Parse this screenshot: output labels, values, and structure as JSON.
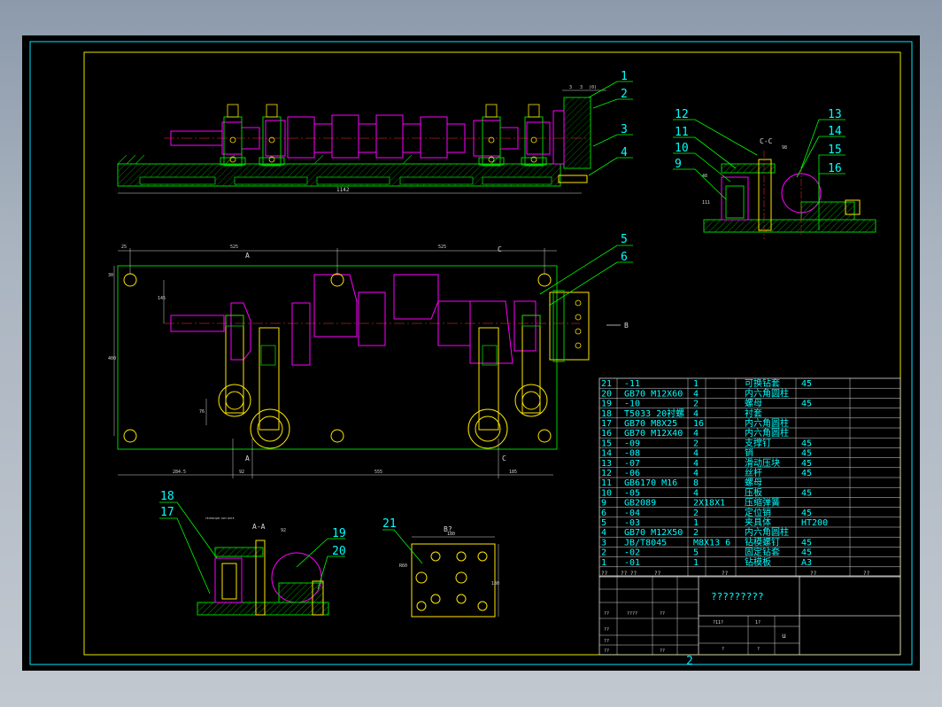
{
  "sheet": {
    "sheet_number": "2",
    "border_color": "#00e5ff",
    "frame_color": "#e6e600"
  },
  "colors": {
    "part_green": "#00d000",
    "shaft_magenta": "#ff00ff",
    "dim_white": "#d8d8d8",
    "leader_green": "#00ff00",
    "text_cyan": "#00ffff",
    "bolt_yellow": "#ffe600",
    "center_red": "#ff3030"
  },
  "front_view": {
    "dimension_overall": "1142",
    "dims_top": [
      "3",
      "3",
      "(0)"
    ],
    "balloons": [
      "1",
      "2",
      "3",
      "4"
    ]
  },
  "top_view": {
    "dims": {
      "left_offset": "25",
      "span_left": "525",
      "span_right": "525",
      "height": "400",
      "side_a": "30",
      "side_b": "145",
      "bottom_left": "284.5",
      "bottom_mid": "92",
      "bottom_span": "555",
      "bottom_right": "185",
      "small_v": "76"
    },
    "section_marks": [
      "A",
      "C",
      "A",
      "C",
      "B"
    ],
    "balloons": [
      "5",
      "6"
    ]
  },
  "view_cc": {
    "title": "C-C",
    "dim": "98",
    "side_dim": "48",
    "small_dim": "111",
    "balloons": [
      "12",
      "11",
      "10",
      "9",
      "13",
      "14",
      "15",
      "16"
    ]
  },
  "view_aa": {
    "title": "A-A",
    "dim": "92",
    "note": "TECHNIQUE DIM NOTE",
    "balloons": [
      "18",
      "17",
      "19",
      "20"
    ]
  },
  "view_b": {
    "title": "B?",
    "dim_top": "180",
    "dim_side": "180",
    "hole_dim": "R60",
    "balloons": [
      "21"
    ]
  },
  "bom": {
    "rows": [
      {
        "no": "21",
        "code": "-11",
        "qty": "1",
        "name": "可换钻套",
        "mat": "45"
      },
      {
        "no": "20",
        "code": "GB70    M12X60",
        "qty": "4",
        "name": "内六角圆柱",
        "mat": ""
      },
      {
        "no": "19",
        "code": "-10",
        "qty": "2",
        "name": "螺母",
        "mat": "45"
      },
      {
        "no": "18",
        "code": "T5033   20衬螺",
        "qty": "4",
        "name": "衬套",
        "mat": ""
      },
      {
        "no": "17",
        "code": "GB70    M8X25",
        "qty": "16",
        "name": "内六角圆柱",
        "mat": ""
      },
      {
        "no": "16",
        "code": "GB70    M12X40",
        "qty": "4",
        "name": "内六角圆柱",
        "mat": ""
      },
      {
        "no": "15",
        "code": "-09",
        "qty": "2",
        "name": "支撑钉",
        "mat": "45"
      },
      {
        "no": "14",
        "code": "-08",
        "qty": "4",
        "name": "销",
        "mat": "45"
      },
      {
        "no": "13",
        "code": "-07",
        "qty": "4",
        "name": "滑动压块",
        "mat": "45"
      },
      {
        "no": "12",
        "code": "-06",
        "qty": "4",
        "name": "丝杆",
        "mat": "45"
      },
      {
        "no": "11",
        "code": "GB6170 M16",
        "qty": "8",
        "name": "螺母",
        "mat": ""
      },
      {
        "no": "10",
        "code": "-05",
        "qty": "4",
        "name": "压板",
        "mat": "45"
      },
      {
        "no": "9",
        "code": "GB2089",
        "qty": "2X18X1",
        "name": "压缩弹簧",
        "mat": ""
      },
      {
        "no": "6",
        "code": "-04",
        "qty": "2",
        "name": "定位销",
        "mat": "45"
      },
      {
        "no": "5",
        "code": "-03",
        "qty": "1",
        "name": "夹具体",
        "mat": "HT200"
      },
      {
        "no": "4",
        "code": "GB70    M12X50",
        "qty": "2",
        "name": "内六角圆柱",
        "mat": ""
      },
      {
        "no": "3",
        "code": "JB/T8045",
        "qty": "M8X13 6",
        "name": "钻模螺钉",
        "mat": "45"
      },
      {
        "no": "2",
        "code": "-02",
        "qty": "5",
        "name": "固定钻套",
        "mat": "45"
      },
      {
        "no": "1",
        "code": "-01",
        "qty": "1",
        "name": "钻模板",
        "mat": "A3"
      }
    ],
    "header": [
      "??",
      "??  ??",
      "??",
      "??",
      "??",
      "??"
    ]
  },
  "title_block": {
    "drawing_name": "?????????",
    "placeholder_a": "??",
    "placeholder_b": "????",
    "placeholder_c": "?11?",
    "placeholder_d": "1?",
    "placeholder_e": "?",
    "scale": "u"
  }
}
